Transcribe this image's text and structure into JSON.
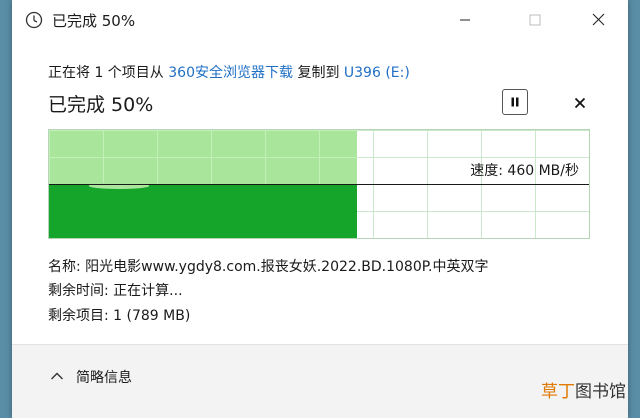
{
  "window": {
    "title": "已完成 50%",
    "controls": [
      "minimize-icon",
      "maximize-icon",
      "close-icon"
    ]
  },
  "copy": {
    "prefix": "正在将 1 个项目从 ",
    "source": "360安全浏览器下载",
    "middle": " 复制到 ",
    "destination": "U396 (E:)"
  },
  "progress": {
    "heading": "已完成 50%",
    "percent": 50,
    "speed_label": "速度: 460 MB/秒",
    "pause_icon": "pause-icon",
    "cancel_icon": "close-icon"
  },
  "details": {
    "name": "名称: 阳光电影www.ygdy8.com.报丧女妖.2022.BD.1080P.中英双字",
    "time_remaining": "剩余时间: 正在计算...",
    "items_remaining": "剩余项目: 1 (789 MB)"
  },
  "footer": {
    "less_details_label": "简略信息",
    "less_details_icon": "chevron-up-icon"
  },
  "watermark": {
    "part1": "草丁",
    "part2": "图书馆"
  },
  "colors": {
    "accent_link": "#1f6fc5",
    "graph_light": "#a9e59a",
    "graph_dark": "#15a52a"
  }
}
